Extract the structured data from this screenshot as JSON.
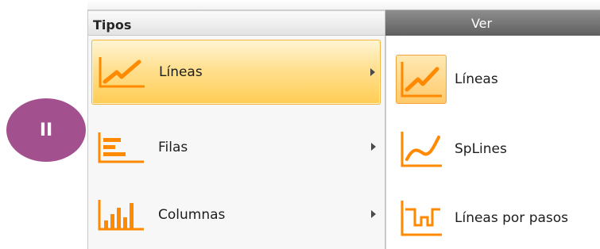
{
  "badge": {
    "text": "II"
  },
  "menu": {
    "header": "Tipos",
    "items": [
      {
        "label": "Líneas",
        "icon": "line-chart-icon",
        "highlighted": true
      },
      {
        "label": "Filas",
        "icon": "bar-chart-horizontal-icon",
        "highlighted": false
      },
      {
        "label": "Columnas",
        "icon": "column-chart-icon",
        "highlighted": false
      }
    ]
  },
  "submenu": {
    "header": "Ver",
    "items": [
      {
        "label": "Líneas",
        "icon": "line-chart-icon",
        "highlighted": true
      },
      {
        "label": "SpLines",
        "icon": "spline-chart-icon",
        "highlighted": false
      },
      {
        "label": "Líneas por pasos",
        "icon": "step-line-chart-icon",
        "highlighted": false
      }
    ]
  },
  "colors": {
    "accent": "#ff8a00",
    "highlight": "#ffd670",
    "badge": "#a3508e"
  }
}
